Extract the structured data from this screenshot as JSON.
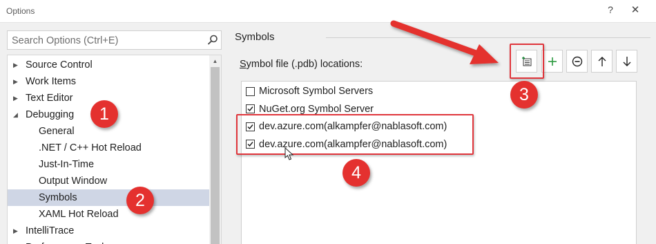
{
  "window": {
    "title": "Options",
    "help_glyph": "?",
    "close_glyph": "✕"
  },
  "search": {
    "placeholder": "Search Options (Ctrl+E)",
    "icon": "search-icon"
  },
  "tree": {
    "items": [
      {
        "label": "Source Control",
        "expander": "▶",
        "level": 0
      },
      {
        "label": "Work Items",
        "expander": "▶",
        "level": 0
      },
      {
        "label": "Text Editor",
        "expander": "▶",
        "level": 0
      },
      {
        "label": "Debugging",
        "expander": "◢",
        "level": 0,
        "expanded": true
      },
      {
        "label": "General",
        "expander": "",
        "level": 1
      },
      {
        "label": ".NET / C++ Hot Reload",
        "expander": "",
        "level": 1
      },
      {
        "label": "Just-In-Time",
        "expander": "",
        "level": 1
      },
      {
        "label": "Output Window",
        "expander": "",
        "level": 1
      },
      {
        "label": "Symbols",
        "expander": "",
        "level": 1,
        "selected": true
      },
      {
        "label": "XAML Hot Reload",
        "expander": "",
        "level": 1
      },
      {
        "label": "IntelliTrace",
        "expander": "▶",
        "level": 0
      },
      {
        "label": "Performance Tools",
        "expander": "▶",
        "level": 0
      }
    ]
  },
  "panel": {
    "section_title": "Symbols",
    "locations_label_underlined": "S",
    "locations_label_rest": "ymbol file (.pdb) locations:",
    "toolbar": [
      {
        "name": "new-location-icon",
        "tooltip": ""
      },
      {
        "name": "add-icon",
        "tooltip": ""
      },
      {
        "name": "remove-icon",
        "tooltip": ""
      },
      {
        "name": "move-up-icon",
        "tooltip": ""
      },
      {
        "name": "move-down-icon",
        "tooltip": ""
      }
    ],
    "locations": [
      {
        "label": "Microsoft Symbol Servers",
        "checked": false
      },
      {
        "label": "NuGet.org Symbol Server",
        "checked": true
      },
      {
        "label": "dev.azure.com(alkampfer@nablasoft.com)",
        "checked": true
      },
      {
        "label": "dev.azure.com(alkampfer@nablasoft.com)",
        "checked": true
      }
    ]
  },
  "annotations": {
    "badges": [
      "1",
      "2",
      "3",
      "4"
    ],
    "color": "#e4312f"
  }
}
